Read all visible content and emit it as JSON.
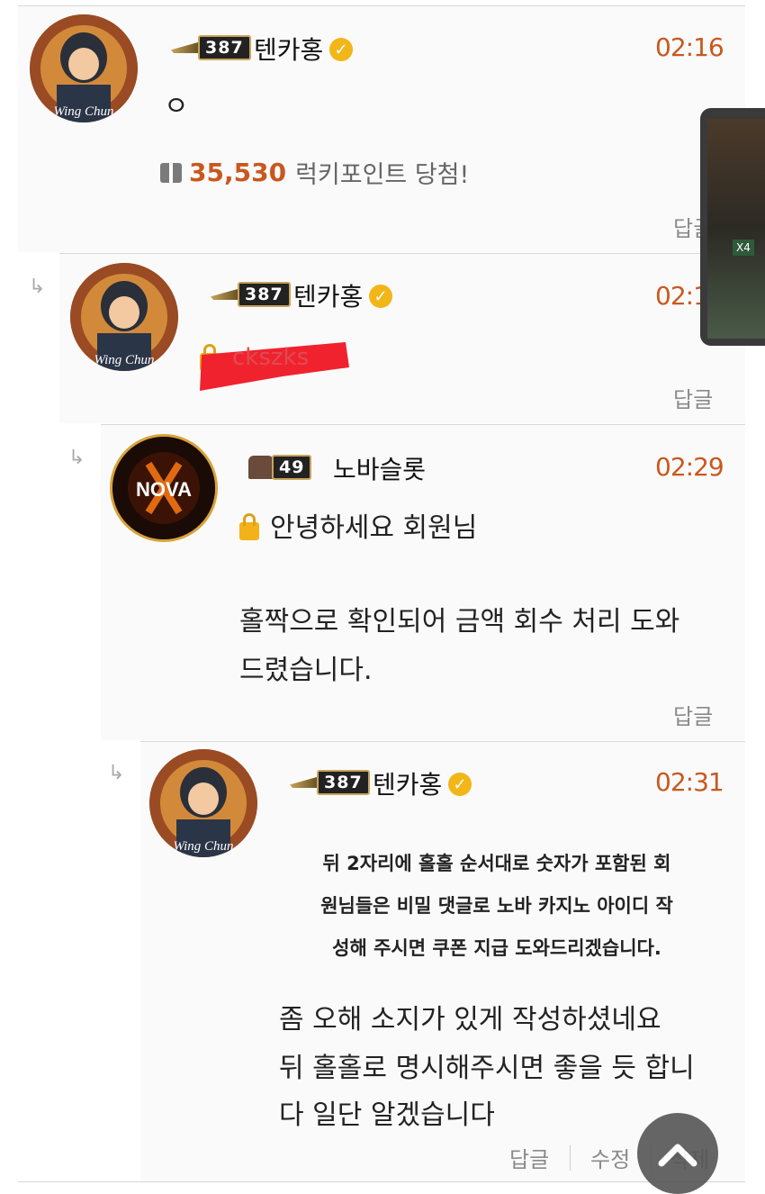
{
  "comments": [
    {
      "nickname": "텐카홍",
      "level": "387",
      "time": "02:16",
      "body": "ㅇ",
      "lucky_points": "35,530",
      "lucky_text": "럭키포인트 당첨!",
      "reply_label": "답글"
    },
    {
      "nickname": "텐카홍",
      "level": "387",
      "time": "02:1",
      "body_redacted": "ckszks",
      "reply_label": "답글"
    },
    {
      "nickname": "노바슬롯",
      "level": "49",
      "time": "02:29",
      "secret_line": "안녕하세요 회원님",
      "body_lines": [
        "홀짝으로 확인되어 금액 회수 처리 도와",
        "드렸습니다."
      ],
      "reply_label": "답글"
    },
    {
      "nickname": "텐카홍",
      "level": "387",
      "time": "02:31",
      "notice_lines": [
        "뒤 2자리에 홀홀 순서대로 숫자가 포함된 회",
        "원님들은 비밀 댓글로 노바 카지노 아이디 작",
        "성해 주시면 쿠폰 지급 도와드리겠습니다."
      ],
      "body_lines": [
        "좀 오해 소지가 있게 작성하셨네요",
        "뒤 홀홀로 명시해주시면 좋을 듯 합니",
        "다 일단 알겠습니다"
      ],
      "actions": [
        "답글",
        "수정",
        "삭제"
      ]
    }
  ],
  "avatar_caption": "Wing Chun",
  "nova_logo_text": "NOVA",
  "float_thumb_label": "X4",
  "colors": {
    "time": "#c8581f",
    "lucky": "#c8581f",
    "verify": "#f2b619"
  }
}
